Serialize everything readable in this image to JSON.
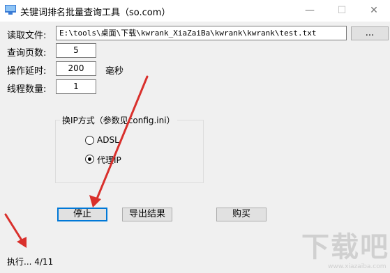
{
  "window": {
    "title": "关键词排名批量查询工具（so.com）",
    "minimize": "—",
    "maximize": "☐",
    "close": "✕"
  },
  "form": {
    "file_label": "读取文件:",
    "file_path": "E:\\tools\\桌面\\下载\\kwrank_XiaZaiBa\\kwrank\\kwrank\\test.txt",
    "browse_label": "...",
    "pages_label": "查询页数:",
    "pages_value": "5",
    "delay_label": "操作延时:",
    "delay_value": "200",
    "delay_unit": "毫秒",
    "threads_label": "线程数量:",
    "threads_value": "1"
  },
  "ip_group": {
    "title": "换IP方式（参数见config.ini）",
    "options": [
      {
        "label": "ADSL",
        "checked": false
      },
      {
        "label": "代理IP",
        "checked": true
      }
    ]
  },
  "buttons": {
    "stop": "停止",
    "export": "导出结果",
    "buy": "购买"
  },
  "status": {
    "text": "执行... 4/11"
  },
  "watermark": {
    "text": "下载吧",
    "sub": "www.xiazaiba.com"
  },
  "colors": {
    "arrow": "#d9302c",
    "focus_border": "#0078d7"
  }
}
